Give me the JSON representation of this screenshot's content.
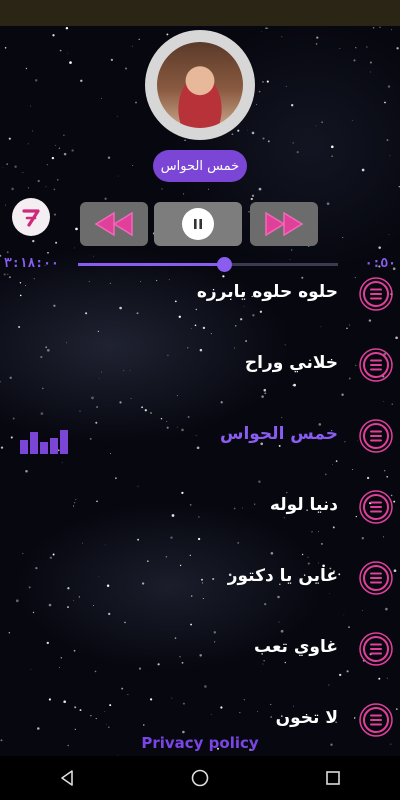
{
  "status_bar": {},
  "player": {
    "artist_label": "خمس الحواس",
    "time_total": "٣:١٨:٠٠",
    "time_current": "٠:٥٠",
    "progress": 0.56
  },
  "tracks": [
    {
      "title": "حلوه حلوه يابرزه",
      "active": false
    },
    {
      "title": "خلاني وراح",
      "active": false
    },
    {
      "title": "خمس الحواس",
      "active": true
    },
    {
      "title": "دنيا لوله",
      "active": false
    },
    {
      "title": "عاين يا دكتور",
      "active": false
    },
    {
      "title": "غاوي تعب",
      "active": false
    },
    {
      "title": "لا تخون",
      "active": false
    }
  ],
  "footer": {
    "privacy_label": "Privacy policy"
  },
  "colors": {
    "accent": "#7b45d6",
    "active_text": "#8a5cf0",
    "menu_pink": "#e0409a"
  },
  "icons": [
    "seven-logo-icon",
    "previous-icon",
    "pause-icon",
    "next-icon",
    "equalizer-icon",
    "menu-icon",
    "back-icon",
    "home-icon",
    "recents-icon"
  ]
}
